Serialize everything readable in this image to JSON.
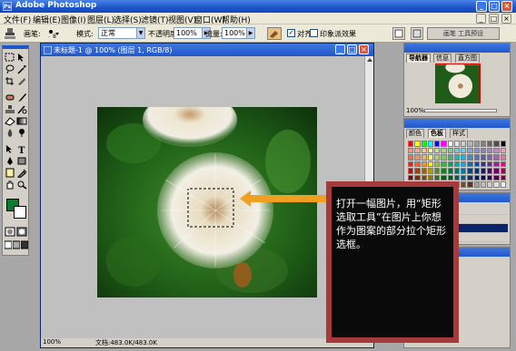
{
  "app": {
    "title": "Adobe Photoshop",
    "logo_letters": "Ps",
    "window_buttons": [
      "_",
      "□",
      "×"
    ]
  },
  "menu": [
    "文件(F)",
    "编辑(E)",
    "图像(I)",
    "图层(L)",
    "选择(S)",
    "滤镜(T)",
    "视图(V)",
    "窗口(W)",
    "帮助(H)"
  ],
  "options_bar": {
    "brush_label": "画笔:",
    "brush_size": "8",
    "mode_label": "模式:",
    "mode_value": "正常",
    "opacity_label": "不透明度:",
    "opacity_value": "100%",
    "flow_label": "流量:",
    "flow_value": "100%",
    "align_label": "对齐",
    "align_checked": true,
    "impressionist_label": "印象派效果",
    "impressionist_checked": false,
    "palette_well_label": "画笔 工具预设"
  },
  "document": {
    "title": "未标题-1 @ 100% (图层 1, RGB/8)",
    "zoom": "100%",
    "doc_info": "文档:483.0K/483.0K"
  },
  "palettes": {
    "navigator": {
      "tabs": [
        "导航器",
        "信息",
        "直方图"
      ],
      "zoom": "100%"
    },
    "color": {
      "tabs": [
        "颜色",
        "色板",
        "样式"
      ]
    }
  },
  "swatch_colors": [
    "#ff0000",
    "#ffff00",
    "#00ff00",
    "#00ffff",
    "#0000ff",
    "#ff00ff",
    "#ffffff",
    "#e6e6e6",
    "#cccccc",
    "#b3b3b3",
    "#999999",
    "#808080",
    "#666666",
    "#4d4d4d",
    "#000000",
    "#f7977a",
    "#fbad82",
    "#fdc68c",
    "#fff799",
    "#c6df9c",
    "#a4d49d",
    "#81ca9d",
    "#7bcdc9",
    "#6ccff7",
    "#7ea7d8",
    "#8493ca",
    "#8881be",
    "#a286bd",
    "#bc8cbf",
    "#f49bc1",
    "#f26c4f",
    "#f68e56",
    "#fbaf5a",
    "#fff467",
    "#acd372",
    "#7dc473",
    "#39b778",
    "#16bcb4",
    "#00bff3",
    "#438ccb",
    "#5574b9",
    "#605ca9",
    "#855fa8",
    "#a763a9",
    "#ef6ea8",
    "#ed1c24",
    "#f26522",
    "#f7941d",
    "#fff200",
    "#8dc63f",
    "#39b54a",
    "#00a651",
    "#00a99d",
    "#00aeef",
    "#0072bc",
    "#0054a5",
    "#2e3192",
    "#662d91",
    "#92278f",
    "#ec008c",
    "#aa1111",
    "#a0410d",
    "#a36209",
    "#aba000",
    "#588528",
    "#197b30",
    "#007236",
    "#00746b",
    "#0076a4",
    "#004a80",
    "#003471",
    "#1b1464",
    "#440e62",
    "#630460",
    "#9b005d",
    "#790000",
    "#7b2e00",
    "#7d4900",
    "#827b00",
    "#406618",
    "#005e20",
    "#005826",
    "#005952",
    "#005b7f",
    "#003663",
    "#002157",
    "#0d004c",
    "#32004b",
    "#4b0049",
    "#7b0046",
    "#c7b299",
    "#998675",
    "#736357",
    "#534741",
    "#37302d",
    "#c69c6d",
    "#a67c52",
    "#8c6239",
    "#754c24",
    "#603913",
    "#a0a0a0",
    "#c0c0c0",
    "#d4d0c8",
    "#e0e0e0",
    "#f0f0f0"
  ],
  "callout": {
    "text": "打开一幅图片，用“矩形选取工具”在图片上你想作为图案的部分拉个矩形选框。"
  },
  "colors": {
    "foreground": "#0a7a2e",
    "background": "#ffffff",
    "callout_border": "#a63a3a",
    "arrow": "#f0a020"
  }
}
